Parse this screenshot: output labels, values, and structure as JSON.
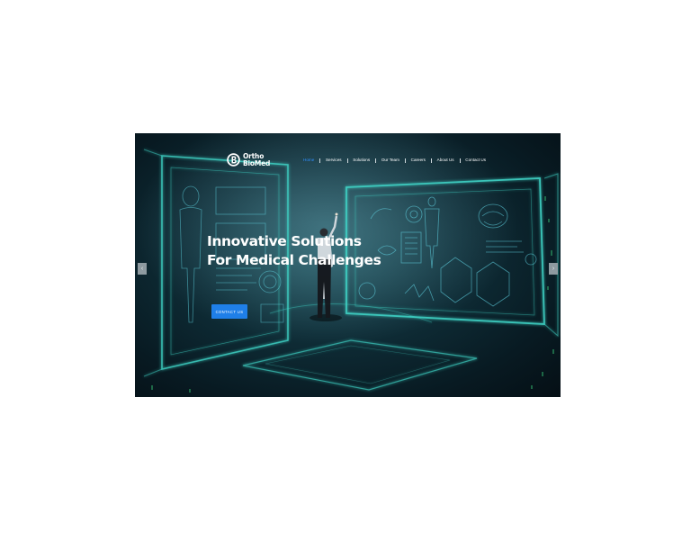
{
  "brand": {
    "name_line1": "Ortho",
    "name_line2": "BioMed",
    "logo_icon": "ob-monogram-icon"
  },
  "nav": {
    "items": [
      {
        "label": "Home",
        "active": true
      },
      {
        "label": "Services",
        "active": false
      },
      {
        "label": "Solutions",
        "active": false
      },
      {
        "label": "Our Team",
        "active": false
      },
      {
        "label": "Careers",
        "active": false
      },
      {
        "label": "About Us",
        "active": false
      },
      {
        "label": "Contact Us",
        "active": false
      }
    ]
  },
  "hero": {
    "headline_line1": "Innovative Solutions",
    "headline_line2": "For Medical Challenges",
    "cta_label": "CONTACT US",
    "prev_icon": "chevron-left-icon",
    "next_icon": "chevron-right-icon",
    "prev_glyph": "‹",
    "next_glyph": "›"
  },
  "colors": {
    "accent": "#1f7fe8",
    "active_nav": "#2f8fff",
    "hero_dark": "#081a22",
    "glow": "#3fd6c8"
  }
}
